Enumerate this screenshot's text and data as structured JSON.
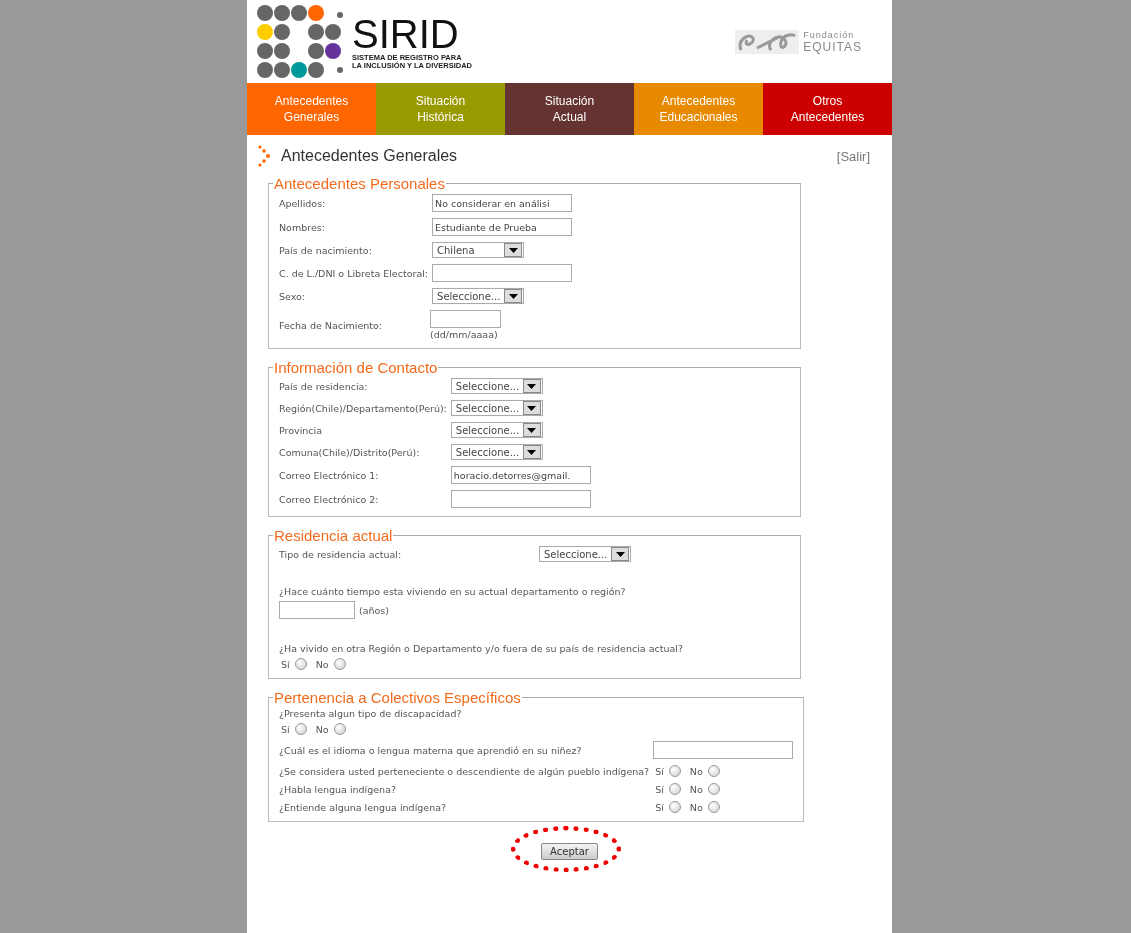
{
  "header": {
    "logo_title": "SIRID",
    "logo_subtitle": [
      "SISTEMA DE REGISTRO PARA",
      "LA INCLUSIÓN Y LA DIVERSIDAD"
    ],
    "partner_top": "Fundación",
    "partner_name": "EQUITAS"
  },
  "nav": [
    {
      "lines": [
        "Antecedentes",
        "Generales"
      ],
      "color": "#ff6600"
    },
    {
      "lines": [
        "Situación",
        "Histórica"
      ],
      "color": "#999900"
    },
    {
      "lines": [
        "Situación",
        "Actual"
      ],
      "color": "#663333"
    },
    {
      "lines": [
        "Antecedentes",
        "Educacionales"
      ],
      "color": "#e88a00"
    },
    {
      "lines": [
        "Otros",
        "Antecedentes"
      ],
      "color": "#cc0000"
    }
  ],
  "page_title": "Antecedentes Generales",
  "logout": "[Salir]",
  "sections": [
    {
      "title": "Antecedentes Personales",
      "rows": [
        {
          "kind": "input",
          "label": "Apellidos:",
          "value": "No considerar en análisi"
        },
        {
          "kind": "input",
          "label": "Nombres:",
          "value": "Estudiante de Prueba"
        },
        {
          "kind": "select",
          "label": "País de nacimiento:",
          "value": "Chilena"
        },
        {
          "kind": "input",
          "label": "C. de L./DNI o Libreta Electoral:",
          "value": ""
        },
        {
          "kind": "select",
          "label": "Sexo:",
          "value": "Seleccione..."
        },
        {
          "kind": "date",
          "label": "Fecha de Nacimiento:",
          "hint": "(dd/mm/aaaa)"
        }
      ]
    },
    {
      "title": "Información de Contacto",
      "rows": [
        {
          "kind": "select",
          "label": "País de residencia:",
          "value": "Seleccione..."
        },
        {
          "kind": "select",
          "label": "Región(Chile)/Departamento(Perú):",
          "value": "Seleccione..."
        },
        {
          "kind": "select",
          "label": "Provincia",
          "value": "Seleccione..."
        },
        {
          "kind": "select",
          "label": "Comuna(Chile)/Distrito(Perú):",
          "value": "Seleccione..."
        },
        {
          "kind": "input",
          "label": "Correo Electrónico 1:",
          "value": "horacio.detorres@gmail."
        },
        {
          "kind": "input",
          "label": "Correo Electrónico 2:",
          "value": ""
        }
      ]
    },
    {
      "title": "Residencia actual",
      "rows": [
        {
          "kind": "select",
          "label": "Tipo de residencia actual:",
          "value": "Seleccione..."
        },
        {
          "kind": "stacked-input",
          "label": "¿Hace cuánto tiempo esta viviendo en su actual departamento o región?",
          "unit": "(años)"
        },
        {
          "kind": "stacked-radio",
          "label": "¿Ha vivido en otra Región o Departamento y/o fuera de su país de residencia actual?",
          "options": [
            {
              "label": "Sí",
              "selected": false
            },
            {
              "label": "No",
              "selected": false
            }
          ]
        }
      ]
    },
    {
      "title": "Pertenencia a Colectivos Específicos",
      "rows": [
        {
          "kind": "stacked-radio",
          "label": "¿Presenta algun tipo de discapacidad?",
          "options": [
            {
              "label": "Sí",
              "selected": false
            },
            {
              "label": "No",
              "selected": false
            }
          ]
        },
        {
          "kind": "input",
          "label": "¿Cuál es el idioma o lengua materna que aprendió en su niñez?",
          "value": ""
        },
        {
          "kind": "radio",
          "label": "¿Se considera usted perteneciente o descendiente de algún pueblo indígena?",
          "options": [
            {
              "label": "Sí",
              "selected": false
            },
            {
              "label": "No",
              "selected": false
            }
          ]
        },
        {
          "kind": "radio",
          "label": "¿Habla lengua indígena?",
          "options": [
            {
              "label": "Sí",
              "selected": false
            },
            {
              "label": "No",
              "selected": false
            }
          ]
        },
        {
          "kind": "radio",
          "label": "¿Entiende alguna lengua indígena?",
          "options": [
            {
              "label": "Sí",
              "selected": false
            },
            {
              "label": "No",
              "selected": false
            }
          ]
        }
      ]
    }
  ],
  "submit": "Aceptar"
}
